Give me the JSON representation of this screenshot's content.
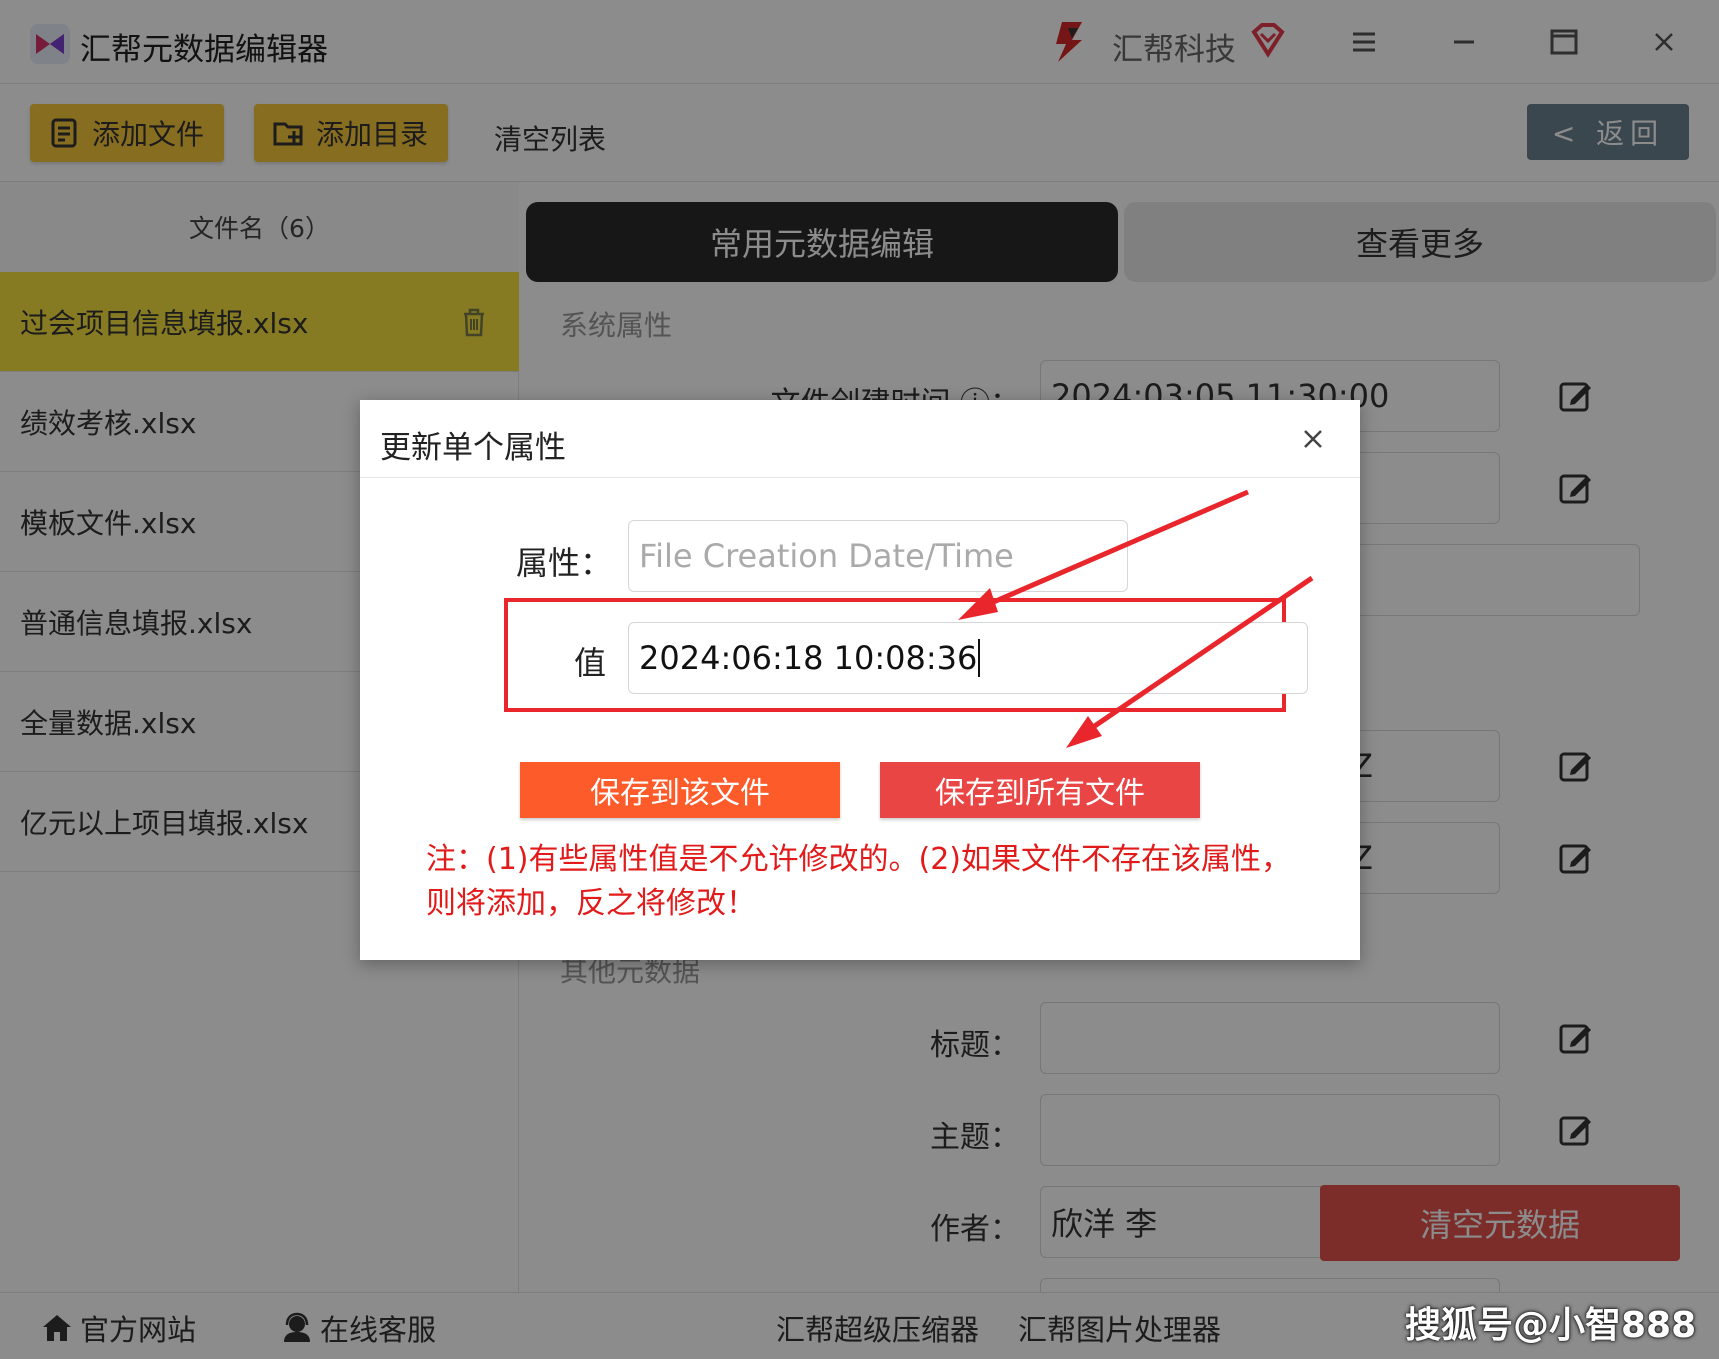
{
  "window": {
    "title": "汇帮元数据编辑器",
    "brand": "汇帮科技"
  },
  "toolbar": {
    "add_file": "添加文件",
    "add_folder": "添加目录",
    "clear_list": "清空列表",
    "back": "< 返回"
  },
  "file_list": {
    "header": "文件名（6）",
    "files": [
      "过会项目信息填报.xlsx",
      "绩效考核.xlsx",
      "模板文件.xlsx",
      "普通信息填报.xlsx",
      "全量数据.xlsx",
      "亿元以上项目填报.xlsx"
    ],
    "selected_index": 0
  },
  "tabs": {
    "common": "常用元数据编辑",
    "more": "查看更多"
  },
  "system_props": {
    "section_title": "系统属性",
    "created_label": "文件创建时间",
    "created_value": "2024:03:05 11:30:00",
    "row4_value_tail": "Z",
    "row5_value_tail": "Z"
  },
  "other_meta": {
    "section_title": "其他元数据",
    "title_label": "标题：",
    "subject_label": "主题：",
    "author_label": "作者：",
    "author_value": "欣洋 李",
    "clear_meta": "清空元数据"
  },
  "footer": {
    "website": "官方网站",
    "support": "在线客服",
    "compressor": "汇帮超级压缩器",
    "image_tool": "汇帮图片处理器",
    "watermark": "搜狐号@小智888"
  },
  "dialog": {
    "title": "更新单个属性",
    "attr_label": "属性：",
    "attr_placeholder": "File Creation Date/Time",
    "value_label": "值",
    "value": "2024:06:18 10:08:36",
    "save_this": "保存到该文件",
    "save_all": "保存到所有文件",
    "note": "注：(1)有些属性值是不允许修改的。(2)如果文件不存在该属性，则将添加，反之将修改！"
  },
  "colors": {
    "accent_yellow": "#f5c63a",
    "selected_row": "#f5e041",
    "save_this": "#fe5b2a",
    "save_all": "#ea4545",
    "note_red": "#e21a1a",
    "highlight_red": "#e8262b"
  }
}
